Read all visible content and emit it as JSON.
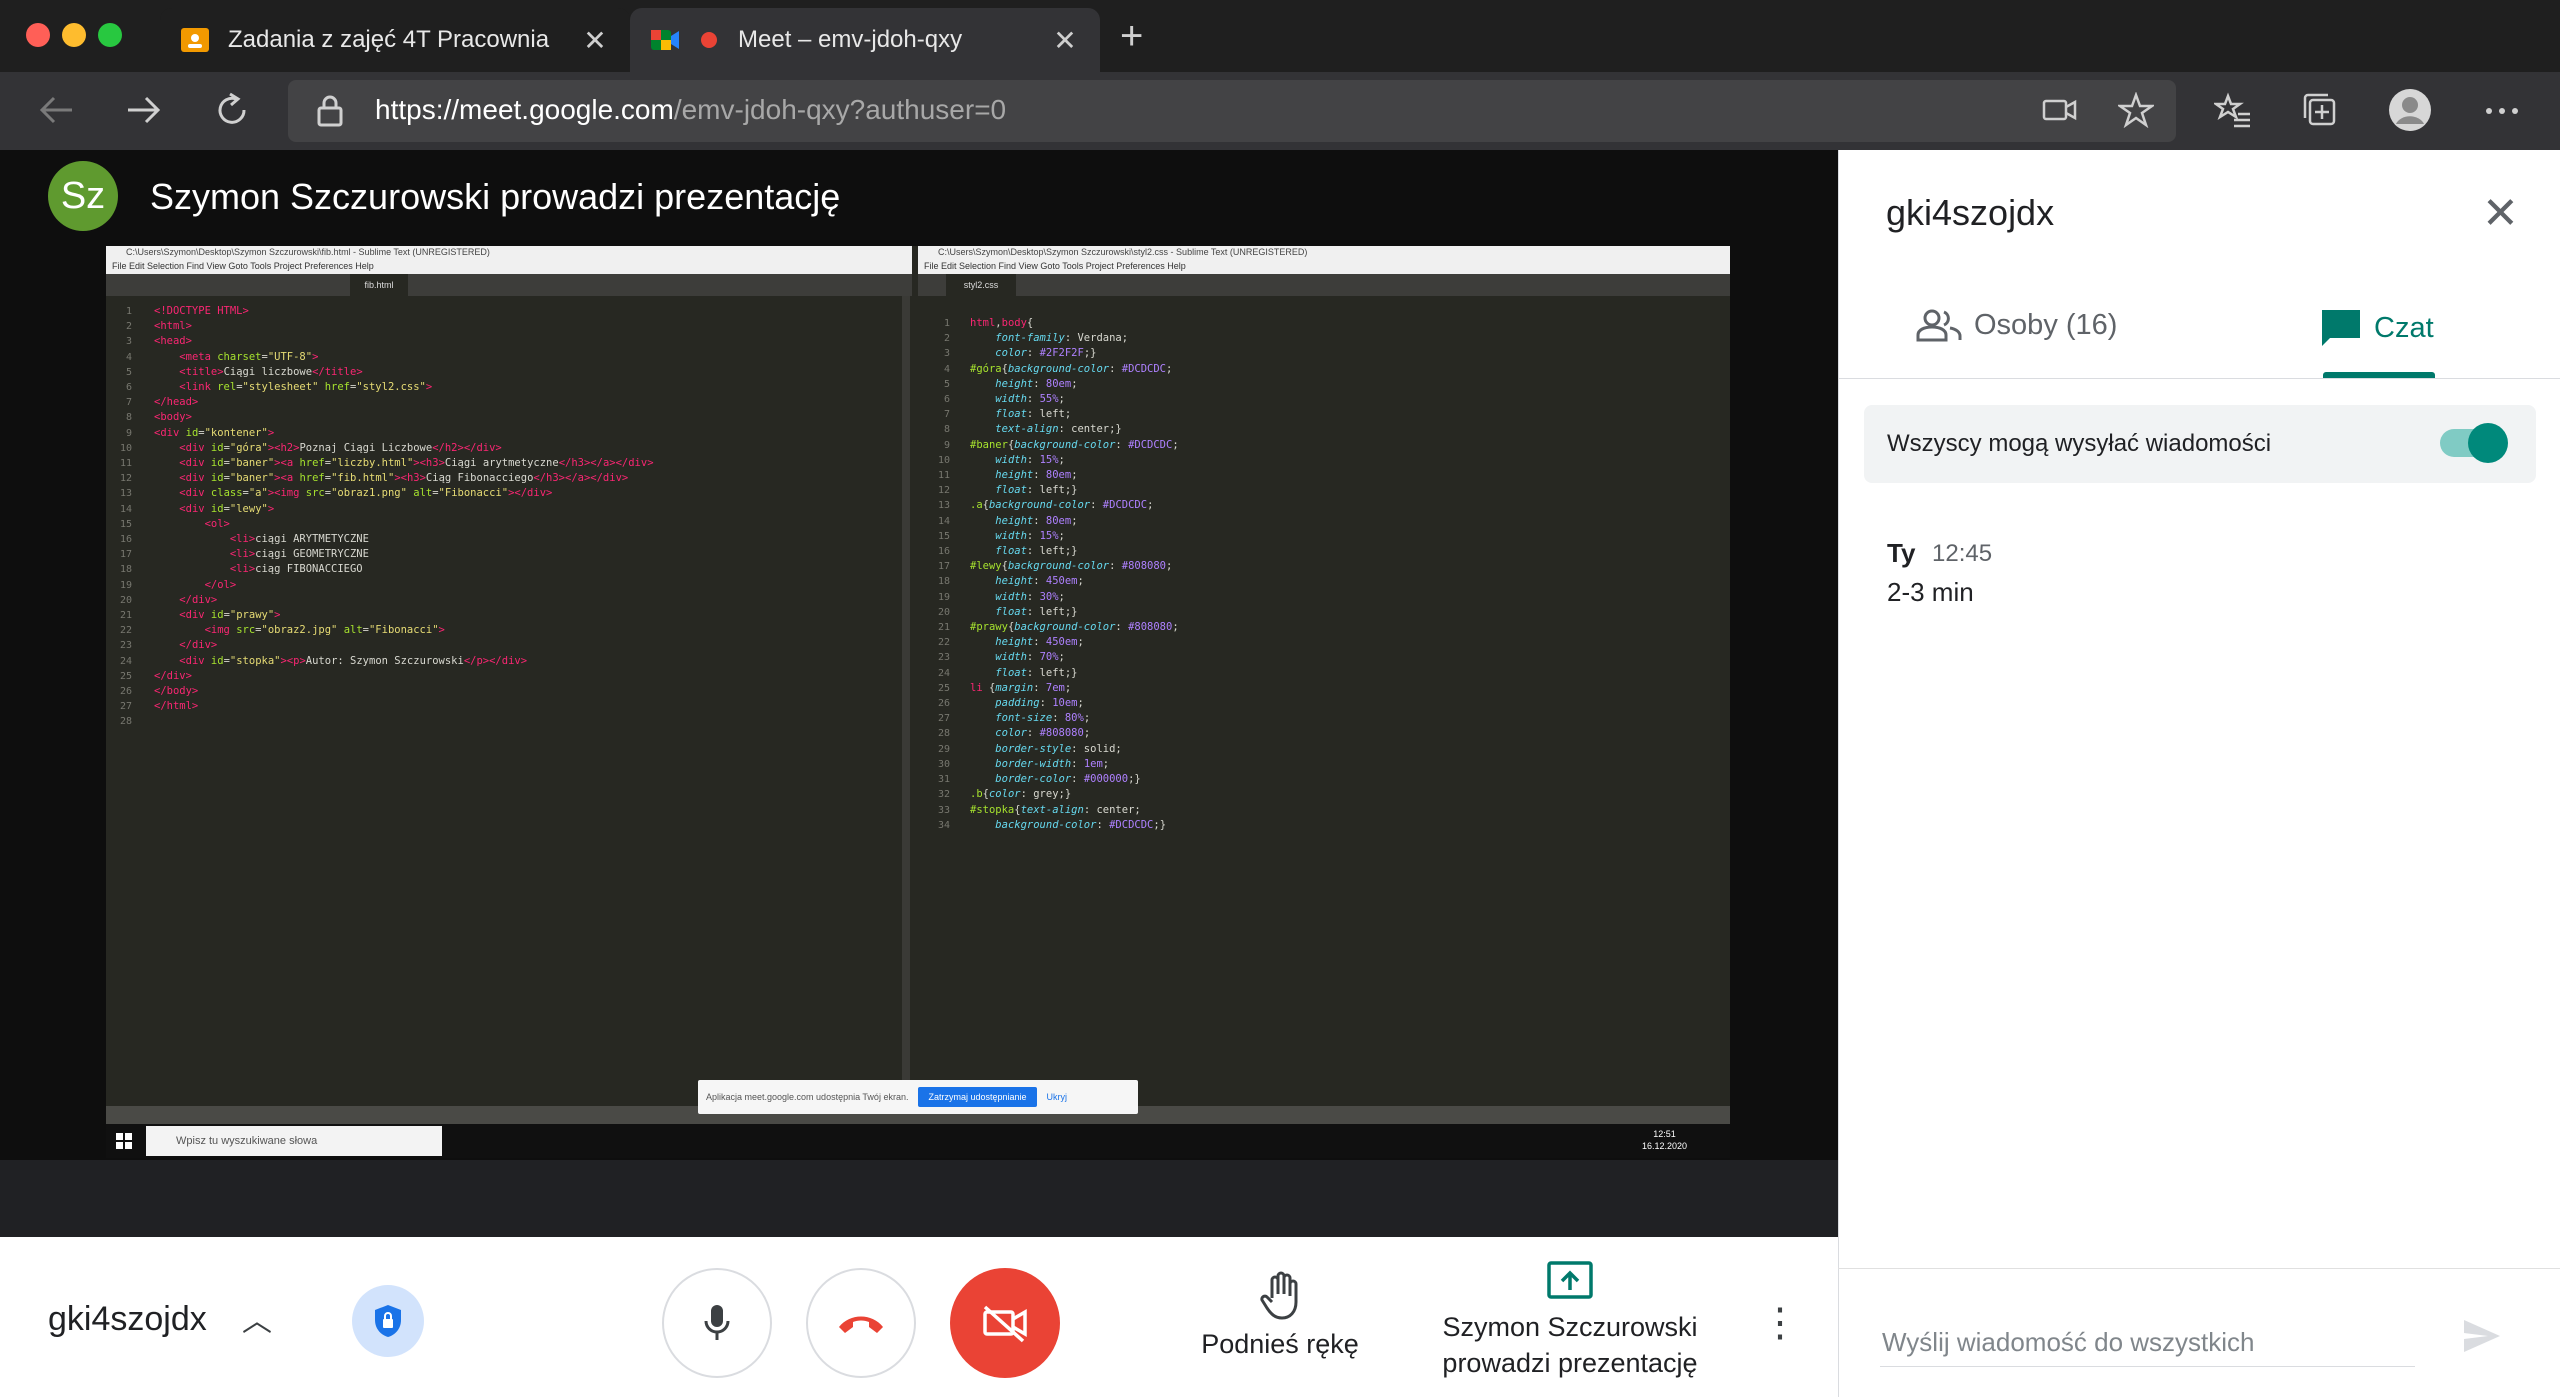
{
  "browser": {
    "tabs": [
      {
        "title": "Zadania z zajęć 4T Pracownia",
        "close": "✕",
        "favicon_color": "#f29900"
      },
      {
        "title": "Meet – emv-jdoh-qxy",
        "close": "✕",
        "recording_color": "#ea4335"
      }
    ],
    "new_tab": "+",
    "url_host": "https://meet.google.com",
    "url_path": "/emv-jdoh-qxy?authuser=0"
  },
  "presentation": {
    "presenter_initials": "Sz",
    "avatar_color": "#5f9a2f",
    "title": "Szymon Szczurowski prowadzi prezentację",
    "left_window": {
      "title": "C:\\Users\\Szymon\\Desktop\\Szymon Szczurowski\\fib.html - Sublime Text (UNREGISTERED)",
      "menu": "File   Edit   Selection   Find   View   Goto   Tools   Project   Preferences   Help",
      "active_tab": "fib.html"
    },
    "right_window": {
      "title": "C:\\Users\\Szymon\\Desktop\\Szymon Szczurowski\\styl2.css - Sublime Text (UNREGISTERED)",
      "menu": "File   Edit   Selection   Find   View   Goto   Tools   Project   Preferences   Help",
      "active_tab": "styl2.css"
    },
    "share_notice": "Aplikacja meet.google.com udostępnia Twój ekran.",
    "share_stop": "Zatrzymaj udostępnianie",
    "share_hide": "Ukryj",
    "taskbar_search": "Wpisz tu wyszukiwane słowa",
    "clock_time": "12:51",
    "clock_date": "16.12.2020"
  },
  "controls": {
    "meeting_code": "gki4szojdx",
    "chevron": "︿",
    "raise_hand": "Podnieś rękę",
    "presenting": "Szymon Szczurowski prowadzi prezentację",
    "more": "⋮",
    "hangup_color": "#ea4335"
  },
  "side_panel": {
    "title": "gki4szojdx",
    "close": "✕",
    "tab_people": "Osoby (16)",
    "tab_chat": "Czat",
    "accent": "#00796b",
    "setting_label": "Wszyscy mogą wysyłać wiadomości",
    "setting_enabled": true,
    "messages": [
      {
        "sender": "Ty",
        "time": "12:45",
        "text": "2-3 min"
      }
    ],
    "input_placeholder": "Wyślij wiadomość do wszystkich"
  }
}
